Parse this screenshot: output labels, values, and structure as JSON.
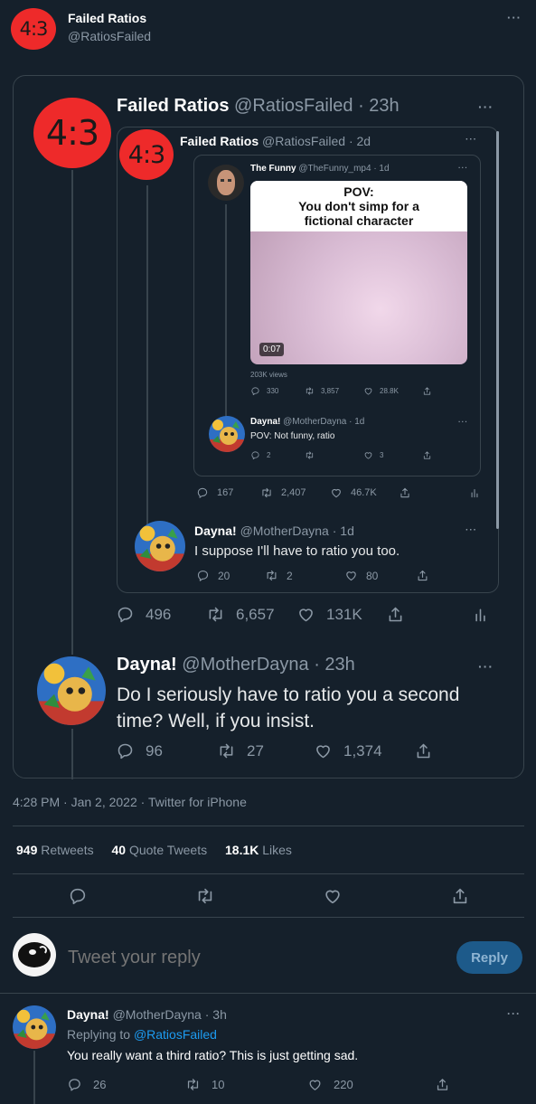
{
  "header": {
    "avatar": "4:3",
    "name": "Failed Ratios",
    "handle": "@RatiosFailed",
    "more": "···"
  },
  "q1": {
    "avatar": "4:3",
    "name": "Failed Ratios",
    "handle": "@RatiosFailed",
    "time": "· 23h",
    "more": "···"
  },
  "q2": {
    "avatar": "4:3",
    "name": "Failed Ratios",
    "handle": "@RatiosFailed",
    "time": "· 2d",
    "more": "···"
  },
  "q3": {
    "name": "The Funny",
    "handle": "@TheFunny_mp4",
    "time": "· 1d",
    "more": "···",
    "video": {
      "caption_line1": "POV:",
      "caption_line2": "You don't simp for a",
      "caption_line3": "fictional character",
      "duration": "0:07",
      "views": "203K views"
    },
    "stats": {
      "replies": "330",
      "retweets": "3,857",
      "likes": "28.8K"
    }
  },
  "q3_reply": {
    "name": "Dayna!",
    "handle": "@MotherDayna",
    "time": "· 1d",
    "more": "···",
    "text": "POV: Not funny, ratio",
    "stats": {
      "replies": "2",
      "retweets": "",
      "likes": "3"
    }
  },
  "q2_stats": {
    "replies": "167",
    "retweets": "2,407",
    "likes": "46.7K"
  },
  "q2_reply": {
    "name": "Dayna!",
    "handle": "@MotherDayna",
    "time": "· 1d",
    "more": "···",
    "text": "I suppose I'll have to ratio you too.",
    "stats": {
      "replies": "20",
      "retweets": "2",
      "likes": "80"
    }
  },
  "q1_stats": {
    "replies": "496",
    "retweets": "6,657",
    "likes": "131K"
  },
  "q1_reply": {
    "name": "Dayna!",
    "handle": "@MotherDayna",
    "time": "· 23h",
    "more": "···",
    "text_line1": "Do I seriously have to ratio you a second",
    "text_line2": "time? Well, if you insist.",
    "stats": {
      "replies": "96",
      "retweets": "27",
      "likes": "1,374"
    }
  },
  "meta": {
    "timestamp": "4:28 PM · Jan 2, 2022 · Twitter for iPhone"
  },
  "counts": {
    "retweets_n": "949",
    "retweets_l": "Retweets",
    "quotes_n": "40",
    "quotes_l": "Quote Tweets",
    "likes_n": "18.1K",
    "likes_l": "Likes"
  },
  "compose": {
    "placeholder": "Tweet your reply",
    "button": "Reply"
  },
  "reply": {
    "name": "Dayna!",
    "handle": "@MotherDayna",
    "time": "· 3h",
    "more": "···",
    "replying_prefix": "Replying to",
    "replying_handle": "@RatiosFailed",
    "text": "You really want a third ratio? This is just getting sad.",
    "stats": {
      "replies": "26",
      "retweets": "10",
      "likes": "220"
    }
  },
  "colors": {
    "background": "#15202b",
    "accent": "#1d9bf0",
    "avatar_red": "#ee2a2a"
  }
}
